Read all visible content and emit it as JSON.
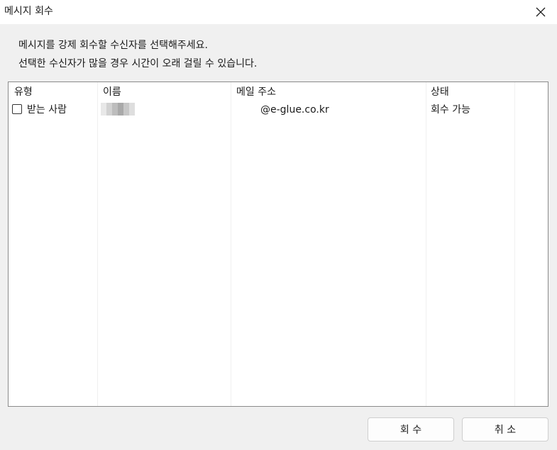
{
  "window": {
    "title": "메시지 회수",
    "close_icon": "close-icon"
  },
  "description": {
    "line1": "메시지를 강제 회수할 수신자를 선택해주세요.",
    "line2": "선택한 수신자가 많을 경우 시간이 오래 걸릴 수 있습니다."
  },
  "recipients_list": {
    "columns": [
      "유형",
      "이름",
      "메일 주소",
      "상태"
    ],
    "rows": [
      {
        "checked": false,
        "type": "받는 사람",
        "name": "",
        "email": "@e-glue.co.kr",
        "status": "회수 가능"
      }
    ]
  },
  "buttons": {
    "recall": "회 수",
    "cancel": "취 소"
  }
}
